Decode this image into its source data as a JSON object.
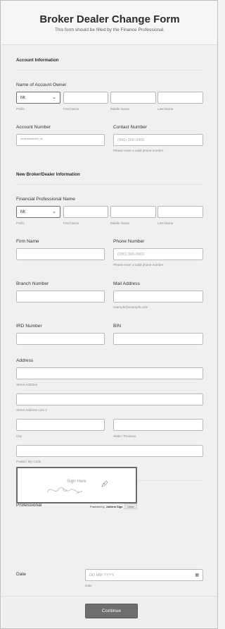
{
  "form": {
    "title": "Broker Dealer Change Form",
    "subtitle": "This form should be filled by the Finance Professional."
  },
  "account_info": {
    "section_title": "Account Information",
    "owner_label": "Name of Account Owner",
    "prefix_value": "Mr.",
    "prefix_sub": "Prefix",
    "first_name_sub": "First Name",
    "middle_name_sub": "Middle Name",
    "last_name_sub": "Last Name",
    "account_number_label": "Account Number",
    "account_number_value": "************.**",
    "contact_number_label": "Contact Number",
    "contact_number_placeholder": "(000) 000-0000",
    "contact_number_hint": "Please enter a valid phone number."
  },
  "broker_info": {
    "section_title": "New Broker/Dealer Information",
    "fp_name_label": "Financial Professional Name",
    "prefix_value": "Mr.",
    "prefix_sub": "Prefix",
    "first_name_sub": "First Name",
    "middle_name_sub": "Middle Name",
    "last_name_sub": "Last Name",
    "firm_name_label": "Firm Name",
    "phone_label": "Phone Number",
    "phone_placeholder": "(000) 000-0000",
    "phone_hint": "Please enter a valid phone number.",
    "branch_label": "Branch Number",
    "mail_label": "Mail Address",
    "mail_hint": "example@example.com",
    "ird_label": "IRD Number",
    "bin_label": "BIN",
    "address_label": "Address",
    "street_sub": "Street Address",
    "street2_sub": "Street Address Line 2",
    "city_sub": "City",
    "state_sub": "State / Province",
    "postal_sub": "Postal / Zip Code"
  },
  "signature": {
    "label": "Signature of Financial Professional",
    "placeholder": "Sign Here",
    "powered_prefix": "Powered by",
    "powered_brand": "Jotform Sign",
    "clear_label": "Clear"
  },
  "date": {
    "label": "Date",
    "placeholder": "DD MM YYYY",
    "sub": "Date",
    "icon": "calendar-icon"
  },
  "footer": {
    "continue_label": "Continue"
  },
  "colors": {
    "button_bg": "#6e6e6e",
    "page_bg": "#f0f0f0",
    "input_border": "#b9b9b9"
  }
}
